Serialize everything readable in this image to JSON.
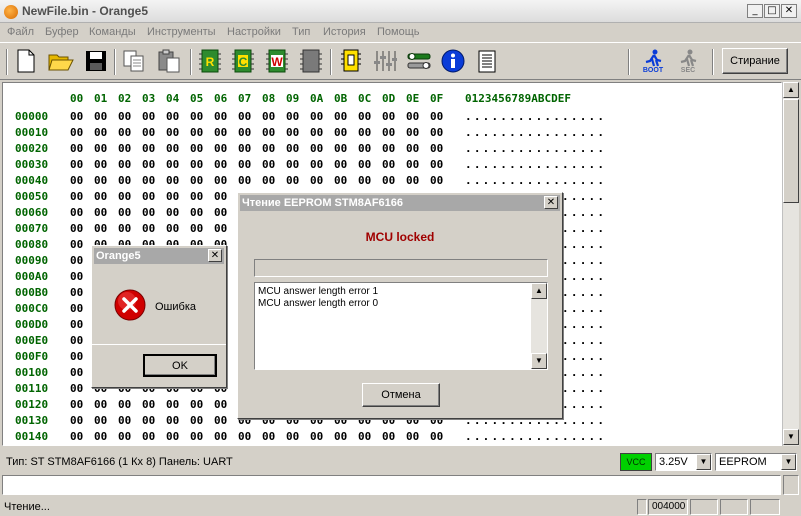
{
  "window": {
    "title": "NewFile.bin - Orange5"
  },
  "menu": [
    "Файл",
    "Буфер",
    "Команды",
    "Инструменты",
    "Настройки",
    "Тип",
    "История",
    "Помощь"
  ],
  "toolbar": {
    "icons": [
      "new-file-icon",
      "open-folder-icon",
      "save-disk-icon",
      "copy-icon",
      "paste-icon",
      "read-chip-icon",
      "compare-chip-icon",
      "write-chip-icon",
      "erase-chip-icon",
      "chip-select-icon",
      "sliders-icon",
      "tools-icon",
      "info-icon",
      "notepad-icon"
    ],
    "chip_letters": {
      "read": "R",
      "compare": "C",
      "write": "W"
    },
    "boot_label": "BOOT",
    "sec_label": "SEC",
    "erase_label": "Стирание"
  },
  "hex": {
    "columns": [
      "00",
      "01",
      "02",
      "03",
      "04",
      "05",
      "06",
      "07",
      "08",
      "09",
      "0A",
      "0B",
      "0C",
      "0D",
      "0E",
      "0F"
    ],
    "ascii_header": "0123456789ABCDEF",
    "rows": [
      "00000",
      "00010",
      "00020",
      "00030",
      "00040",
      "00050",
      "00060",
      "00070",
      "00080",
      "00090",
      "000A0",
      "000B0",
      "000C0",
      "000D0",
      "000E0",
      "000F0",
      "00100",
      "00110",
      "00120",
      "00130",
      "00140"
    ],
    "byte_value": "00",
    "ascii_value": "................"
  },
  "status": {
    "type_info": "Тип: ST STM8AF6166 (1 Кх 8)   Панель: UART",
    "vcc_label": "VCC",
    "voltage": "3.25V",
    "memory": "EEPROM",
    "bottom_text": "Чтение...",
    "address": "004000"
  },
  "eeprom_dialog": {
    "title": "Чтение EEPROM STM8AF6166",
    "message": "MCU locked",
    "log": [
      "MCU answer length error 1",
      "MCU answer length error 0"
    ],
    "cancel_label": "Отмена"
  },
  "error_dialog": {
    "title": "Orange5",
    "message": "Ошибка",
    "ok_label": "OK"
  },
  "colors": {
    "accent_green": "#006400",
    "vcc_green": "#00d000",
    "error_red": "#c00000"
  }
}
